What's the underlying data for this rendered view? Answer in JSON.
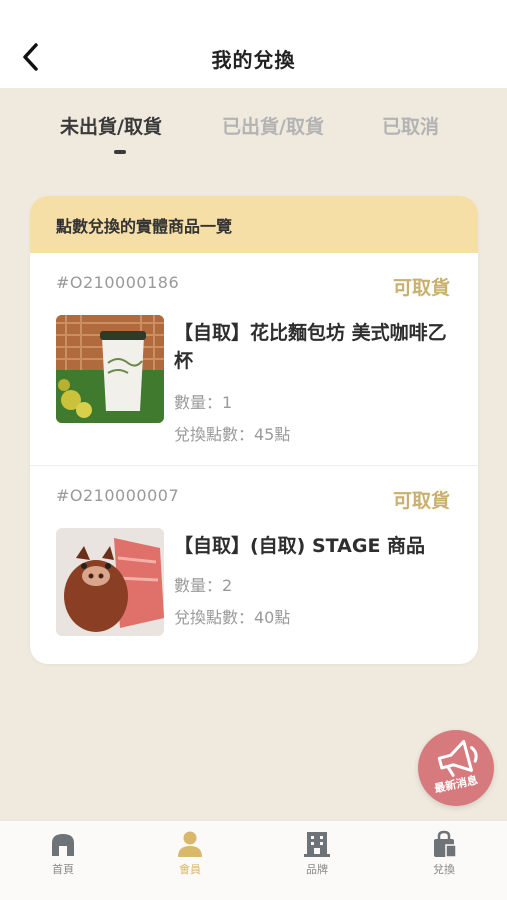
{
  "header": {
    "title": "我的兌換"
  },
  "tabs": [
    {
      "label": "未出貨/取貨",
      "active": true
    },
    {
      "label": "已出貨/取貨",
      "active": false
    },
    {
      "label": "已取消",
      "active": false
    }
  ],
  "card": {
    "title": "點數兌換的實體商品一覽",
    "orders": [
      {
        "id": "#O210000186",
        "status": "可取貨",
        "name": "【自取】花比麵包坊 美式咖啡乙杯",
        "quantity": "數量：1",
        "points": "兌換點數：45點"
      },
      {
        "id": "#O210000007",
        "status": "可取貨",
        "name": "【自取】(自取) STAGE 商品",
        "quantity": "數量：2",
        "points": "兌換點數：40點"
      }
    ]
  },
  "news_button": {
    "label": "最新消息"
  },
  "bottom_nav": {
    "items": [
      {
        "label": "首頁",
        "icon": "home-icon",
        "active": false
      },
      {
        "label": "會員",
        "icon": "member-icon",
        "active": true
      },
      {
        "label": "品牌",
        "icon": "building-icon",
        "active": false
      },
      {
        "label": "兌換",
        "icon": "shopping-bag-icon",
        "active": false
      }
    ]
  },
  "colors": {
    "background": "#efe9de",
    "card_header": "#f6dfa6",
    "status_gold": "#c9b06e",
    "active_nav": "#d9b86a",
    "news_button": "#d67a7e"
  }
}
